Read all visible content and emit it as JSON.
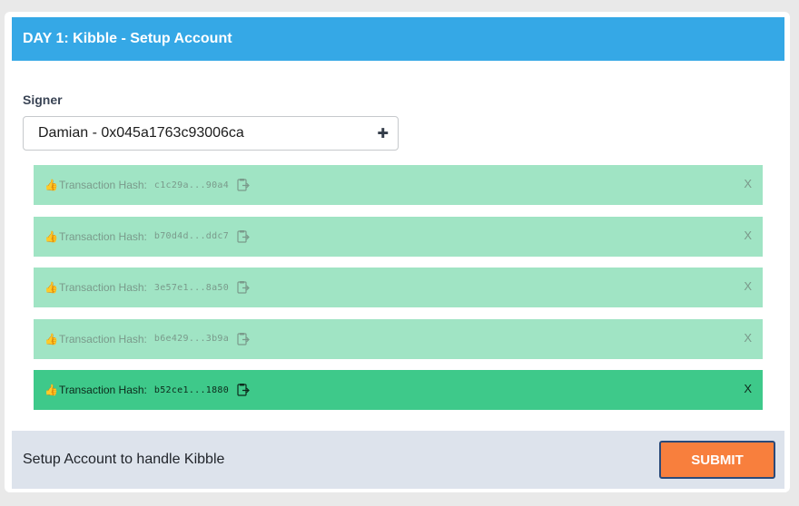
{
  "header": {
    "title": "DAY 1: Kibble - Setup Account"
  },
  "signer": {
    "label": "Signer",
    "selected": "Damian - 0x045a1763c93006ca",
    "chevron_icon": "plus-icon"
  },
  "transactions": [
    {
      "label": "Transaction Hash:",
      "hash": "c1c29a...90a4",
      "close": "X",
      "state": "faded"
    },
    {
      "label": "Transaction Hash:",
      "hash": "b70d4d...ddc7",
      "close": "X",
      "state": "faded"
    },
    {
      "label": "Transaction Hash:",
      "hash": "3e57e1...8a50",
      "close": "X",
      "state": "faded"
    },
    {
      "label": "Transaction Hash:",
      "hash": "b6e429...3b9a",
      "close": "X",
      "state": "faded"
    },
    {
      "label": "Transaction Hash:",
      "hash": "b52ce1...1880",
      "close": "X",
      "state": "active"
    }
  ],
  "footer": {
    "text": "Setup Account to handle Kibble",
    "submit_label": "SUBMIT"
  },
  "colors": {
    "header": "#35a8e6",
    "tx_faded": "#a0e4c4",
    "tx_active": "#3ec98a",
    "submit": "#f87f3d",
    "footer": "#dde3ec"
  }
}
